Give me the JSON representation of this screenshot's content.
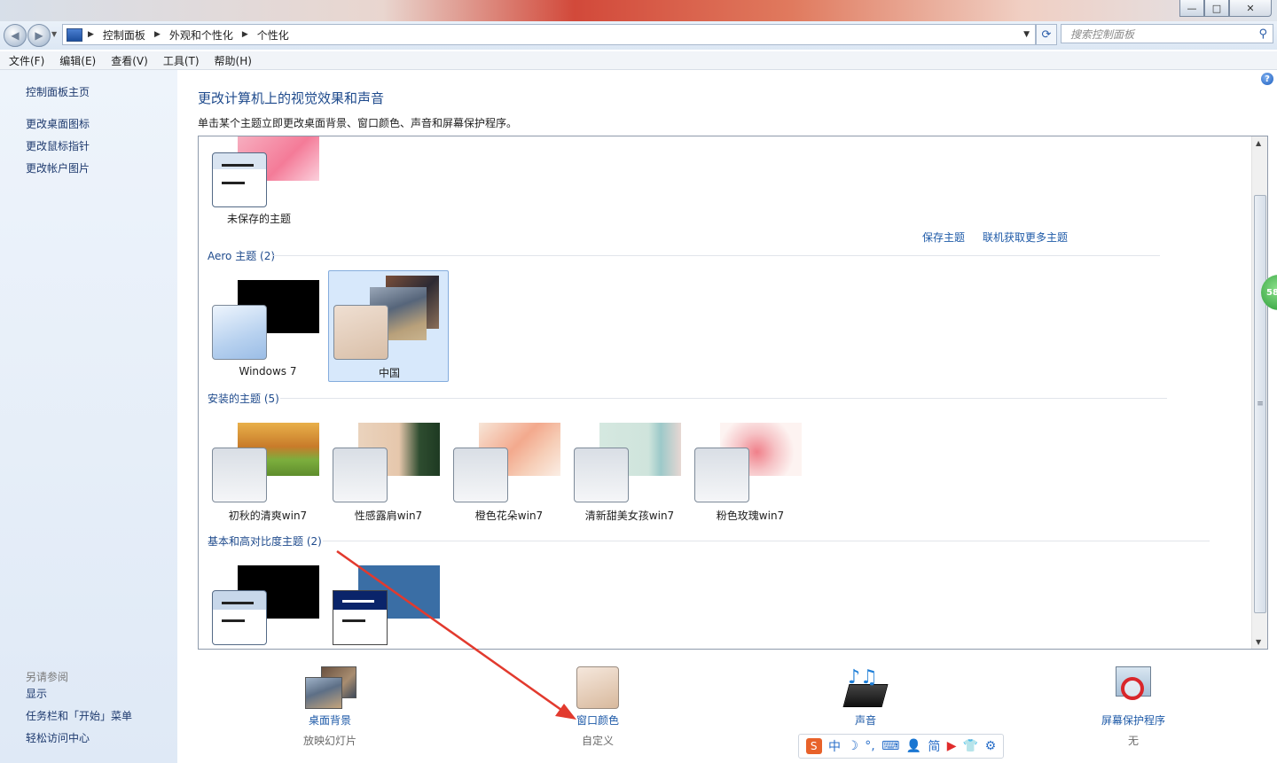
{
  "titlebar": {
    "minimize": "—",
    "maximize": "□",
    "close": "✕"
  },
  "nav": {
    "breadcrumb": [
      "控制面板",
      "外观和个性化",
      "个性化"
    ],
    "search_placeholder": "搜索控制面板"
  },
  "menu": [
    "文件(F)",
    "编辑(E)",
    "查看(V)",
    "工具(T)",
    "帮助(H)"
  ],
  "left_pane": {
    "links": [
      "控制面板主页",
      "更改桌面图标",
      "更改鼠标指针",
      "更改帐户图片"
    ],
    "see_also_title": "另请参阅",
    "see_also": [
      "显示",
      "任务栏和「开始」菜单",
      "轻松访问中心"
    ]
  },
  "main": {
    "title": "更改计算机上的视觉效果和声音",
    "subtitle": "单击某个主题立即更改桌面背景、窗口颜色、声音和屏幕保护程序。",
    "unsaved_theme": "未保存的主题",
    "save_theme": "保存主题",
    "get_more_themes": "联机获取更多主题",
    "groups": [
      {
        "title": "Aero 主题 (2)",
        "themes": [
          "Windows 7",
          "中国"
        ]
      },
      {
        "title": "安装的主题 (5)",
        "themes": [
          "初秋的清爽win7",
          "性感露肩win7",
          "橙色花朵win7",
          "清新甜美女孩win7",
          "粉色玫瑰win7"
        ]
      },
      {
        "title": "基本和高对比度主题 (2)",
        "themes": []
      }
    ],
    "selected_theme": "中国"
  },
  "bottom": [
    {
      "label": "桌面背景",
      "sub": "放映幻灯片"
    },
    {
      "label": "窗口颜色",
      "sub": "自定义"
    },
    {
      "label": "声音",
      "sub": ""
    },
    {
      "label": "屏幕保护程序",
      "sub": "无"
    }
  ],
  "ime": {
    "items": [
      "中",
      "简"
    ]
  },
  "badge": "58",
  "colors": {
    "link": "#1e5aa8",
    "heading": "#1e4a8c",
    "selection": "#d7e8fb",
    "annotation_arrow": "#e23a2e"
  }
}
